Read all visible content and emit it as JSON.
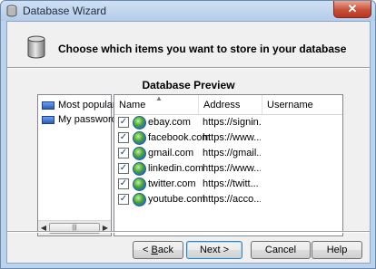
{
  "window": {
    "title": "Database Wizard",
    "close_label": "✕"
  },
  "header": {
    "title": "Choose which items you want to store in your database"
  },
  "preview": {
    "title": "Database Preview"
  },
  "categories": [
    {
      "label": "Most popular"
    },
    {
      "label": "My passwords"
    }
  ],
  "table": {
    "columns": [
      "Name",
      "Address",
      "Username"
    ],
    "rows": [
      {
        "checked": true,
        "name": "ebay.com",
        "address": "https://signin...",
        "username": ""
      },
      {
        "checked": true,
        "name": "facebook.com",
        "address": "https://www....",
        "username": ""
      },
      {
        "checked": true,
        "name": "gmail.com",
        "address": "https://gmail...",
        "username": ""
      },
      {
        "checked": true,
        "name": "linkedin.com",
        "address": "https://www....",
        "username": ""
      },
      {
        "checked": true,
        "name": "twitter.com",
        "address": "https://twitt...",
        "username": ""
      },
      {
        "checked": true,
        "name": "youtube.com",
        "address": "https://acco...",
        "username": ""
      }
    ]
  },
  "buttons": {
    "back": {
      "prefix": "< ",
      "mnemonic": "B",
      "rest": "ack"
    },
    "next": "Next >",
    "cancel": "Cancel",
    "help": "Help"
  },
  "icons": {
    "app": "database-wizard-icon",
    "header": "database-cylinder-icon",
    "category": "folder-icon",
    "site": "globe-icon"
  }
}
